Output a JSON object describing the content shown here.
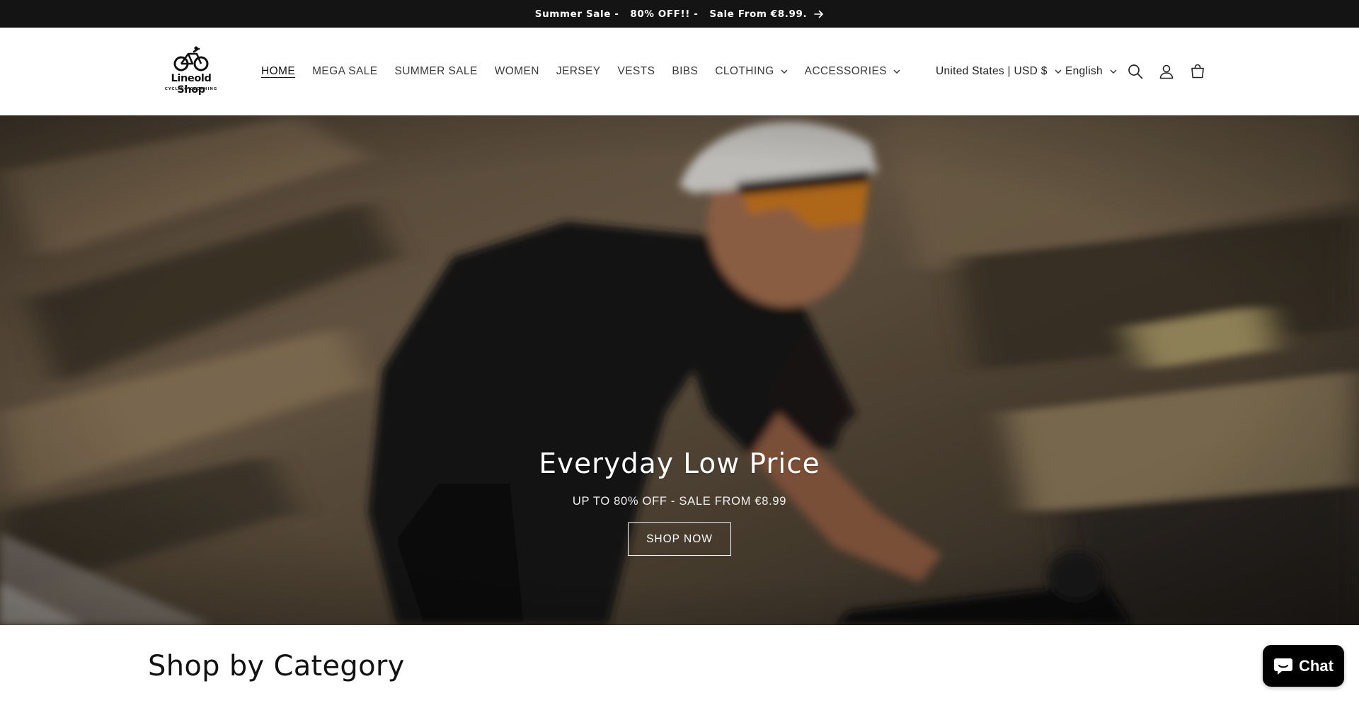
{
  "announcement": {
    "text": "Summer Sale -   80% OFF!! -   Sale From €8.99.",
    "icon": "arrow-right-icon"
  },
  "header": {
    "logo": {
      "name": "Lineold Shop",
      "tagline": "CYCLING CLOTHING",
      "icon": "bicycle-icon"
    },
    "nav": [
      {
        "label": "HOME",
        "active": true
      },
      {
        "label": "MEGA SALE"
      },
      {
        "label": "SUMMER SALE"
      },
      {
        "label": "WOMEN"
      },
      {
        "label": "JERSEY"
      },
      {
        "label": "VESTS"
      },
      {
        "label": "BIBS"
      },
      {
        "label": "CLOTHING",
        "dropdown": true
      },
      {
        "label": "ACCESSORIES",
        "dropdown": true
      }
    ],
    "country_selector": "United States | USD $",
    "language_selector": "English",
    "icons": [
      "search-icon",
      "account-icon",
      "cart-icon"
    ]
  },
  "hero": {
    "title": "Everyday Low Price",
    "subtitle": "UP TO 80% OFF - SALE FROM €8.99",
    "button_label": "SHOP NOW"
  },
  "category_section": {
    "heading": "Shop by Category"
  },
  "chat": {
    "label": "Chat",
    "icon": "chat-bubble-icon"
  },
  "colors": {
    "announcement_bg": "#141414",
    "chat_bg": "#000000",
    "text": "#121212"
  }
}
